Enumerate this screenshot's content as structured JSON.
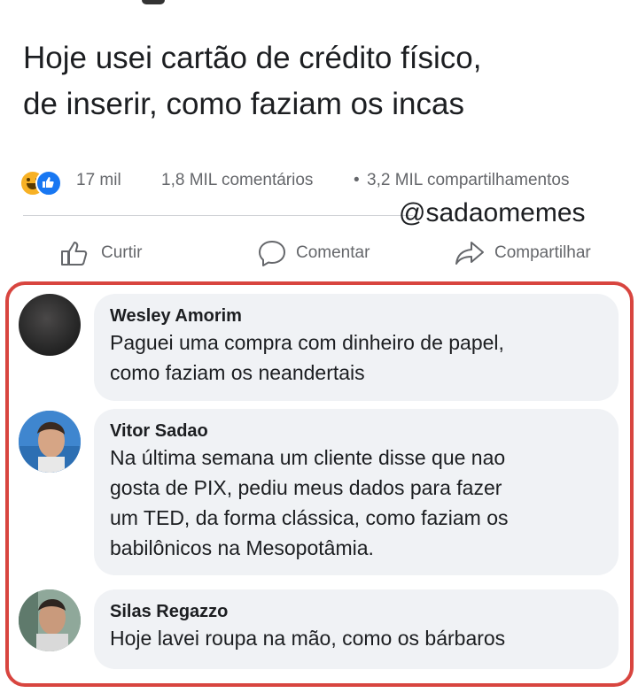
{
  "post": {
    "text_line1": "Hoje usei cartão de crédito físico,",
    "text_line2": "de inserir, como faziam os incas"
  },
  "stats": {
    "reactions": [
      "haha-icon",
      "like-icon"
    ],
    "reaction_count": "17 mil",
    "comments": "1,8 MIL comentários",
    "separator": "•",
    "shares": "3,2 MIL compartilhamentos"
  },
  "watermark": "@sadaomemes",
  "actions": {
    "like": "Curtir",
    "comment": "Comentar",
    "share": "Compartilhar"
  },
  "comments": [
    {
      "author": "Wesley Amorim",
      "lines": [
        "Paguei uma compra com dinheiro de papel,",
        "como faziam os neandertais"
      ]
    },
    {
      "author": "Vitor Sadao",
      "lines": [
        "Na última semana um cliente disse que nao",
        "gosta de PIX, pediu meus dados para fazer",
        "um TED, da forma clássica, como faziam os",
        "babilônicos na Mesopotâmia."
      ]
    },
    {
      "author": "Silas Regazzo",
      "lines": [
        "Hoje lavei roupa na mão, como os bárbaros"
      ]
    }
  ],
  "colors": {
    "highlight": "#d8453f",
    "like_blue": "#1877f2",
    "bubble": "#f0f2f5",
    "muted_text": "#65676b"
  }
}
